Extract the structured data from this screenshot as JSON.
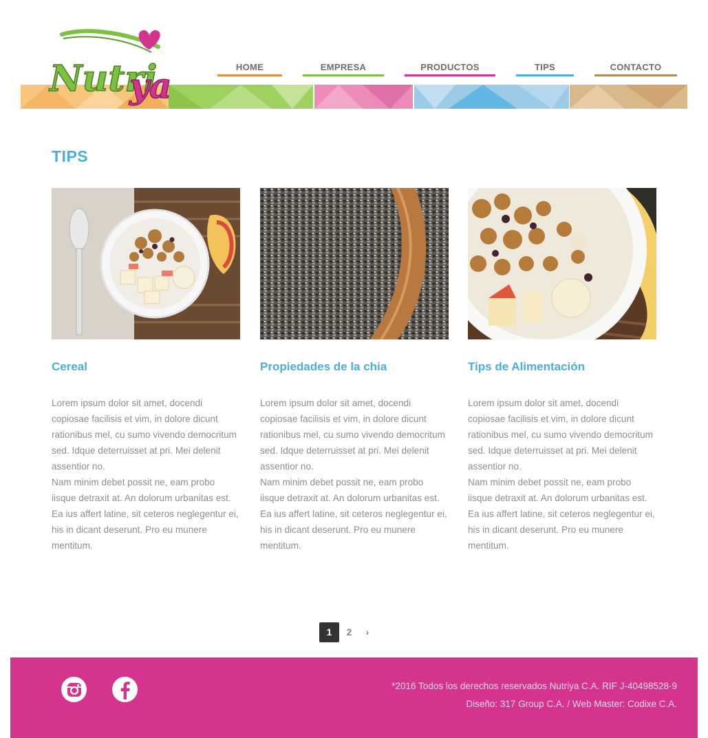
{
  "brand": {
    "logo_text": "Nutriya",
    "accent_pink": "#d4348e",
    "accent_green": "#7dc142",
    "accent_blue": "#4aaee0"
  },
  "nav": {
    "items": [
      {
        "label": "HOME",
        "color": "#e38c48"
      },
      {
        "label": "EMPRESA",
        "color": "#7dc142"
      },
      {
        "label": "PRODUCTOS",
        "color": "#d4348e"
      },
      {
        "label": "TIPS",
        "color": "#4aaee0"
      },
      {
        "label": "CONTACTO",
        "color": "#b08a5a"
      }
    ]
  },
  "page": {
    "title": "TIPS"
  },
  "cards": [
    {
      "title": "Cereal",
      "image_icon": "cereal-bowl-photo",
      "body1": "Lorem ipsum dolor sit amet, docendi copiosae facilisis et vim, in dolore dicunt rationibus mel, cu sumo vivendo democritum sed. Idque deterruisset at pri. Mei delenit assentior no.",
      "body2": "Nam minim debet possit ne, eam probo iisque detraxit at. An dolorum urbanitas est. Ea ius affert latine, sit ceteros neglegentur ei, his in dicant deserunt. Pro eu munere mentitum."
    },
    {
      "title": "Propiedades de la chia",
      "image_icon": "chia-seeds-photo",
      "body1": "Lorem ipsum dolor sit amet, docendi copiosae facilisis et vim, in dolore dicunt rationibus mel, cu sumo vivendo democritum sed. Idque deterruisset at pri. Mei delenit assentior no.",
      "body2": "Nam minim debet possit ne, eam probo iisque detraxit at. An dolorum urbanitas est. Ea ius affert latine, sit ceteros neglegentur ei, his in dicant deserunt. Pro eu munere mentitum."
    },
    {
      "title": "Tips de Alimentación",
      "image_icon": "granola-bowl-photo",
      "body1": "Lorem ipsum dolor sit amet, docendi copiosae facilisis et vim, in dolore dicunt rationibus mel, cu sumo vivendo democritum sed. Idque deterruisset at pri. Mei delenit assentior no.",
      "body2": "Nam minim debet possit ne, eam probo iisque detraxit at. An dolorum urbanitas est. Ea ius affert latine, sit ceteros neglegentur ei, his in dicant deserunt. Pro eu munere mentitum."
    }
  ],
  "pagination": {
    "pages": [
      "1",
      "2"
    ],
    "current": "1",
    "next": "›"
  },
  "footer": {
    "social": [
      {
        "icon": "instagram-icon"
      },
      {
        "icon": "facebook-icon"
      }
    ],
    "copyright": "*2016 Todos los derechos reservados Nutriya C.A. RIF J-40498528-9",
    "credits": "Diseño: 317 Group C.A. / Web Master: Codixe C.A."
  }
}
